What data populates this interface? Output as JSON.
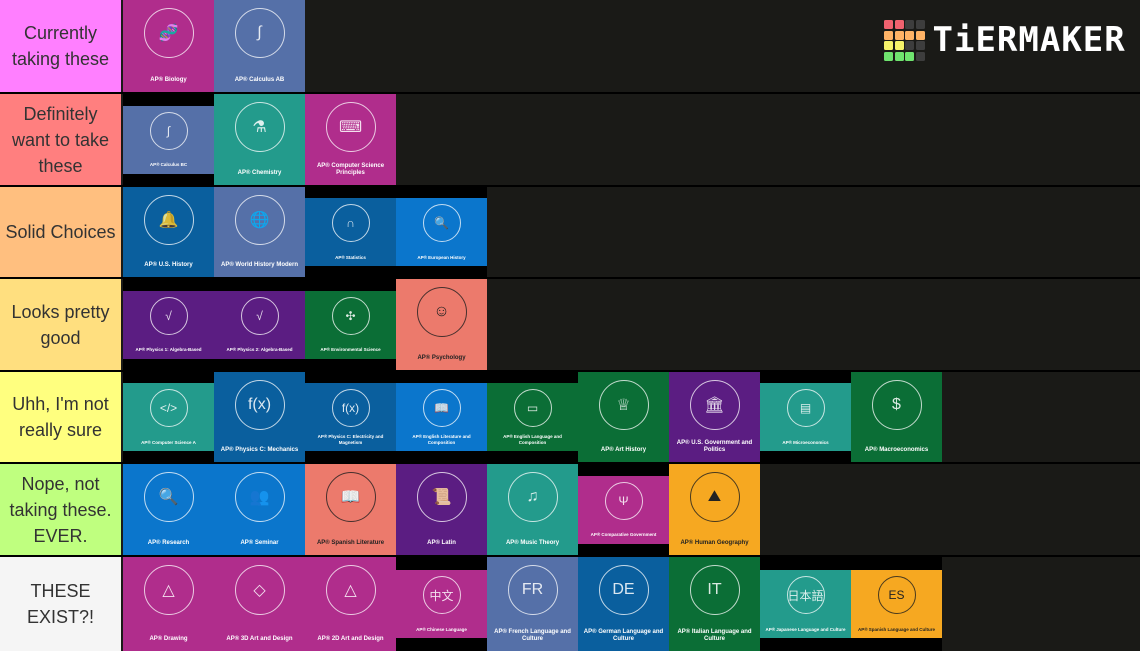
{
  "logo": {
    "text": "TiERMAKER",
    "icon": "tiermaker-grid-icon",
    "grid_colors": [
      "#f0626f",
      "#f0626f",
      "#3d3d3d",
      "#3d3d3d",
      "#ffb366",
      "#ffb366",
      "#ffb366",
      "#ffb366",
      "#f6f36a",
      "#f6f36a",
      "#3d3d3d",
      "#3d3d3d",
      "#6fe46f",
      "#6fe46f",
      "#6fe46f",
      "#3d3d3d"
    ]
  },
  "tiers": [
    {
      "label": "Currently taking these",
      "color": "#ff7fff",
      "items": [
        {
          "caption": "AP® Biology",
          "bg": "#b02d8c",
          "icon": "dna-icon",
          "glyph": "🧬",
          "size": "full"
        },
        {
          "caption": "AP® Calculus AB",
          "bg": "#5570a8",
          "icon": "calculator-icon",
          "glyph": "∫",
          "size": "full"
        }
      ]
    },
    {
      "label": "Definitely want to take these",
      "color": "#ff7f7f",
      "items": [
        {
          "caption": "AP® Calculus BC",
          "bg": "#5570a8",
          "icon": "calculator-icon",
          "glyph": "∫",
          "size": "short"
        },
        {
          "caption": "AP® Chemistry",
          "bg": "#239b8c",
          "icon": "flask-icon",
          "glyph": "⚗",
          "size": "full"
        },
        {
          "caption": "AP® Computer Science Principles",
          "bg": "#b02d8c",
          "icon": "flowchart-icon",
          "glyph": "⌨",
          "size": "full"
        }
      ]
    },
    {
      "label": "Solid Choices",
      "color": "#ffbf7f",
      "items": [
        {
          "caption": "AP® U.S. History",
          "bg": "#0a5f9e",
          "icon": "liberty-bell-icon",
          "glyph": "🔔",
          "size": "full"
        },
        {
          "caption": "AP® World History Modern",
          "bg": "#5570a8",
          "icon": "globe-icon",
          "glyph": "🌐",
          "size": "full"
        },
        {
          "caption": "AP® Statistics",
          "bg": "#0a5f9e",
          "icon": "bell-curve-icon",
          "glyph": "∩",
          "size": "short"
        },
        {
          "caption": "AP® European History",
          "bg": "#0b76cc",
          "icon": "globe-magnifier-icon",
          "glyph": "🔍",
          "size": "short"
        }
      ]
    },
    {
      "label": "Looks pretty good",
      "color": "#ffdf7f",
      "items": [
        {
          "caption": "AP® Physics 1: Algebra-Based",
          "bg": "#5b1d82",
          "icon": "physics-icon",
          "glyph": "√",
          "size": "short"
        },
        {
          "caption": "AP® Physics 2: Algebra-Based",
          "bg": "#5b1d82",
          "icon": "physics-icon",
          "glyph": "√",
          "size": "short"
        },
        {
          "caption": "AP® Environmental Science",
          "bg": "#0b6e36",
          "icon": "windmill-icon",
          "glyph": "✣",
          "size": "short"
        },
        {
          "caption": "AP® Psychology",
          "bg": "#ec7a6c",
          "icon": "brain-head-icon",
          "glyph": "☺",
          "size": "full",
          "dark": true
        }
      ]
    },
    {
      "label": "Uhh, I'm not really sure",
      "color": "#ffff7f",
      "items": [
        {
          "caption": "AP® Computer Science A",
          "bg": "#239b8c",
          "icon": "code-icon",
          "glyph": "</>",
          "size": "short"
        },
        {
          "caption": "AP® Physics C: Mechanics",
          "bg": "#0a5f9e",
          "icon": "robot-arm-icon",
          "glyph": "f(x)",
          "size": "full"
        },
        {
          "caption": "AP® Physics C: Electricity and Magnetism",
          "bg": "#0a5f9e",
          "icon": "lightbulb-icon",
          "glyph": "f(x)",
          "size": "short"
        },
        {
          "caption": "AP® English Literature and Composition",
          "bg": "#0b76cc",
          "icon": "book-icon",
          "glyph": "📖",
          "size": "short"
        },
        {
          "caption": "AP® English Language and Composition",
          "bg": "#0b6e36",
          "icon": "laptop-icon",
          "glyph": "▭",
          "size": "short"
        },
        {
          "caption": "AP® Art History",
          "bg": "#0b6e36",
          "icon": "statue-icon",
          "glyph": "♕",
          "size": "full"
        },
        {
          "caption": "AP® U.S. Government and Politics",
          "bg": "#5b1d82",
          "icon": "capitol-icon",
          "glyph": "🏛",
          "size": "full"
        },
        {
          "caption": "AP® Microeconomics",
          "bg": "#239b8c",
          "icon": "shop-chart-icon",
          "glyph": "▤",
          "size": "short"
        },
        {
          "caption": "AP® Macroeconomics",
          "bg": "#0b6e36",
          "icon": "globe-money-icon",
          "glyph": "$",
          "size": "full"
        }
      ]
    },
    {
      "label": "Nope, not taking these. EVER.",
      "color": "#bfff7f",
      "items": [
        {
          "caption": "AP® Research",
          "bg": "#0b76cc",
          "icon": "research-icon",
          "glyph": "🔍",
          "size": "full"
        },
        {
          "caption": "AP® Seminar",
          "bg": "#0b76cc",
          "icon": "seminar-icon",
          "glyph": "👥",
          "size": "full"
        },
        {
          "caption": "AP® Spanish Literature",
          "bg": "#ec7a6c",
          "icon": "book-windmill-icon",
          "glyph": "📖",
          "size": "full",
          "dark": true
        },
        {
          "caption": "AP® Latin",
          "bg": "#5b1d82",
          "icon": "roman-scroll-icon",
          "glyph": "📜",
          "size": "full"
        },
        {
          "caption": "AP® Music Theory",
          "bg": "#239b8c",
          "icon": "music-notes-icon",
          "glyph": "♫",
          "size": "full"
        },
        {
          "caption": "AP® Comparative Government",
          "bg": "#b02d8c",
          "icon": "columns-icon",
          "glyph": "Ψ",
          "size": "short"
        },
        {
          "caption": "AP® Human Geography",
          "bg": "#f6a821",
          "icon": "landscape-icon",
          "glyph": "⛰",
          "size": "full",
          "dark": true
        }
      ]
    },
    {
      "label": "THESE EXIST?!",
      "color": "#f5f5f5",
      "items": [
        {
          "caption": "AP® Drawing",
          "bg": "#b02d8c",
          "icon": "triangle-hand-icon",
          "glyph": "△",
          "size": "full"
        },
        {
          "caption": "AP® 3D Art and Design",
          "bg": "#b02d8c",
          "icon": "pyramid-hand-icon",
          "glyph": "◇",
          "size": "full"
        },
        {
          "caption": "AP® 2D Art and Design",
          "bg": "#b02d8c",
          "icon": "triangle-hands-icon",
          "glyph": "△",
          "size": "full"
        },
        {
          "caption": "AP® Chinese Language",
          "bg": "#b02d8c",
          "icon": "chinese-crest-icon",
          "glyph": "中文",
          "size": "short"
        },
        {
          "caption": "AP® French Language and Culture",
          "bg": "#5570a8",
          "icon": "francais-crest-icon",
          "glyph": "FR",
          "size": "full"
        },
        {
          "caption": "AP® German Language and Culture",
          "bg": "#0a5f9e",
          "icon": "deutsch-crest-icon",
          "glyph": "DE",
          "size": "full"
        },
        {
          "caption": "AP® Italian Language and Culture",
          "bg": "#0b6e36",
          "icon": "italiano-crest-icon",
          "glyph": "IT",
          "size": "full"
        },
        {
          "caption": "AP® Japanese Language and Culture",
          "bg": "#239b8c",
          "icon": "japanese-crest-icon",
          "glyph": "日本語",
          "size": "short"
        },
        {
          "caption": "AP® Spanish Language and Culture",
          "bg": "#f6a821",
          "icon": "espanol-crest-icon",
          "glyph": "ES",
          "size": "short",
          "dark": true
        }
      ]
    }
  ]
}
